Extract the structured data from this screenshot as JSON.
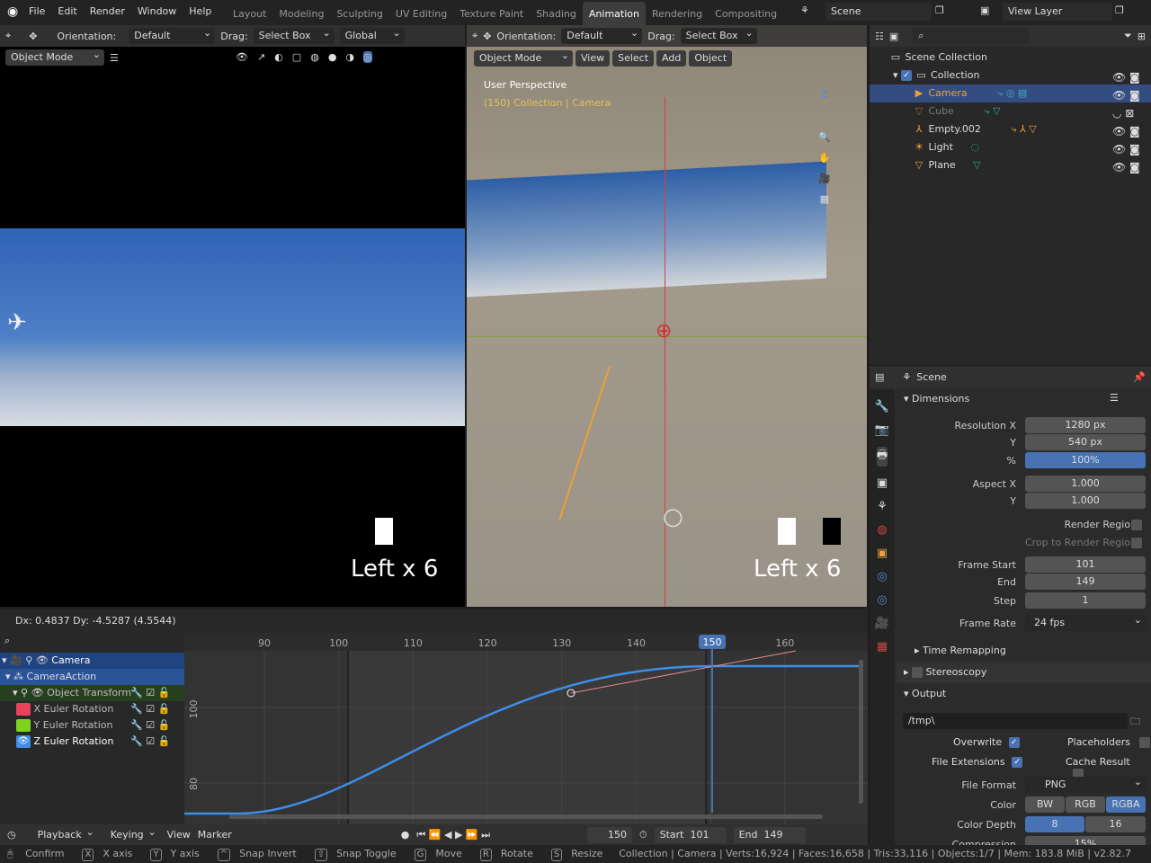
{
  "topbar": {
    "menus": [
      "File",
      "Edit",
      "Render",
      "Window",
      "Help"
    ],
    "workspaces": [
      "Layout",
      "Modeling",
      "Sculpting",
      "UV Editing",
      "Texture Paint",
      "Shading",
      "Animation",
      "Rendering",
      "Compositing"
    ],
    "active_workspace": "Animation",
    "scene": "Scene",
    "view_layer": "View Layer"
  },
  "viewport_left": {
    "orientation_label": "Orientation:",
    "orientation": "Default",
    "drag_label": "Drag:",
    "drag": "Select Box",
    "transform": "Global",
    "mode": "Object Mode",
    "overlay_text": "Left x 6"
  },
  "viewport_right": {
    "orientation_label": "Orientation:",
    "orientation": "Default",
    "drag_label": "Drag:",
    "drag": "Select Box",
    "mode": "Object Mode",
    "menus": [
      "View",
      "Select",
      "Add",
      "Object"
    ],
    "perspective": "User Perspective",
    "context": "(150) Collection | Camera",
    "overlay_text": "Left x 6"
  },
  "outliner": {
    "root": "Scene Collection",
    "items": [
      {
        "name": "Collection",
        "color": "#dddddd"
      },
      {
        "name": "Camera",
        "color": "#e8a040",
        "selected": true
      },
      {
        "name": "Cube",
        "color": "#777777"
      },
      {
        "name": "Empty.002",
        "color": "#dddddd"
      },
      {
        "name": "Light",
        "color": "#dddddd"
      },
      {
        "name": "Plane",
        "color": "#dddddd"
      }
    ]
  },
  "properties": {
    "context": "Scene",
    "dimensions": {
      "title": "Dimensions",
      "res_x_label": "Resolution X",
      "res_x": "1280 px",
      "res_y_label": "Y",
      "res_y": "540 px",
      "pct_label": "%",
      "pct": "100%",
      "aspect_x_label": "Aspect X",
      "aspect_x": "1.000",
      "aspect_y_label": "Y",
      "aspect_y": "1.000",
      "render_region": "Render Region",
      "crop": "Crop to Render Region",
      "frame_start_label": "Frame Start",
      "frame_start": "101",
      "end_label": "End",
      "end": "149",
      "step_label": "Step",
      "step": "1",
      "frame_rate_label": "Frame Rate",
      "frame_rate": "24 fps",
      "time_remapping": "Time Remapping"
    },
    "stereoscopy": "Stereoscopy",
    "output": {
      "title": "Output",
      "path": "/tmp\\",
      "overwrite": "Overwrite",
      "placeholders": "Placeholders",
      "file_extensions": "File Extensions",
      "cache_result": "Cache Result",
      "file_format_label": "File Format",
      "file_format": "PNG",
      "color_label": "Color",
      "color_options": [
        "BW",
        "RGB",
        "RGBA"
      ],
      "color_selected": "RGBA",
      "depth_label": "Color Depth",
      "depth_options": [
        "8",
        "16"
      ],
      "depth_selected": "8",
      "compression_label": "Compression",
      "compression": "15%"
    }
  },
  "graph": {
    "readout": "Dx: 0.4837   Dy: -4.5287 (4.5544)",
    "frame_ticks": [
      "90",
      "100",
      "110",
      "120",
      "130",
      "140",
      "150",
      "160"
    ],
    "current_frame": "150",
    "value_ticks": [
      "100",
      "80"
    ],
    "channels": [
      {
        "name": "Camera"
      },
      {
        "name": "CameraAction"
      },
      {
        "name": "Object Transform"
      },
      {
        "name": "X Euler Rotation",
        "color": "#e8435a"
      },
      {
        "name": "Y Euler Rotation",
        "color": "#7ed321"
      },
      {
        "name": "Z Euler Rotation",
        "color": "#3d8ee8"
      }
    ]
  },
  "timeline": {
    "menus": [
      "Playback",
      "Keying",
      "View",
      "Marker"
    ],
    "frame": "150",
    "start_label": "Start",
    "start": "101",
    "end_label": "End",
    "end": "149"
  },
  "status": {
    "hints": [
      {
        "key": "",
        "label": "Confirm"
      },
      {
        "key": "X",
        "label": "X axis"
      },
      {
        "key": "Y",
        "label": "Y axis"
      },
      {
        "key": "^",
        "label": "Snap Invert"
      },
      {
        "key": "⇧",
        "label": "Snap Toggle"
      },
      {
        "key": "G",
        "label": "Move"
      },
      {
        "key": "R",
        "label": "Rotate"
      },
      {
        "key": "S",
        "label": "Resize"
      }
    ],
    "stats": "Collection | Camera | Verts:16,924 | Faces:16,658 | Tris:33,116 | Objects:1/7 | Mem: 183.8 MiB | v2.82.7"
  }
}
